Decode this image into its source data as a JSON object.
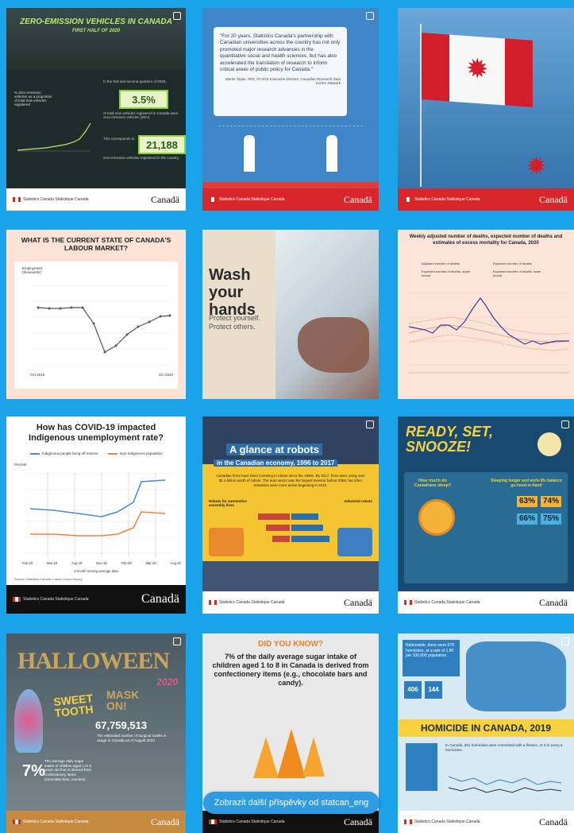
{
  "footer": {
    "canada": "Canadä",
    "gov": "Statistics Canada  Statistique Canada"
  },
  "tiles": {
    "t1": {
      "title": "ZERO-EMISSION VEHICLES IN CANADA",
      "subtitle": "FIRST HALF OF 2020",
      "stat1": "3.5%",
      "stat2": "21,188",
      "note1": "In the first and second quarters of 2020,",
      "note2": "of total new vehicles registered in Canada were zero-emission vehicles (ZEV).",
      "note3": "This corresponds to",
      "note4": "zero-emission vehicles registered in the country.",
      "chart_label": "% Zero-emission vehicles as a proportion of total new vehicles registered"
    },
    "t2": {
      "quote": "\"For 20 years, Statistics Canada's partnership with Canadian universities across the country has not only promoted major research advances in the quantitative social and health sciences, but has also accelerated the translation of research to inform critical areas of public policy for Canada.\"",
      "attribution": "Martin Taylor, PhD, FCAHS Executive Director, Canadian Research Data Centre Network"
    },
    "t4": {
      "title": "WHAT IS THE CURRENT STATE OF CANADA'S LABOUR MARKET?",
      "ylabel": "Employment (thousands)",
      "x_start": "Oct 2019",
      "x_end": "Oct 2020"
    },
    "t5": {
      "title": "Wash your hands",
      "subtitle": "Protect yourself. Protect others."
    },
    "t6": {
      "title": "Weekly adjusted number of deaths, expected number of deaths and estimates of excess mortality for Canada, 2020",
      "legend": [
        "Adjusted number of deaths",
        "Expected number of deaths",
        "Expected number of deaths, upper bound",
        "Expected number of deaths, lower bound"
      ]
    },
    "t7": {
      "title": "How has COVID-19 impacted Indigenous unemployment rate?",
      "legend1": "Indigenous people living off reserve",
      "legend2": "Non-Indigenous population",
      "ylabel": "Percent",
      "xlabel": "3-month moving average data",
      "source": "Source: Statistics Canada, Labour Force Survey",
      "xticks": [
        "Feb-19",
        "Mar-19",
        "Aug-19",
        "Nov-19",
        "Feb-20",
        "Mar-20",
        "Aug-20"
      ]
    },
    "t8": {
      "title": "A glance at robots",
      "subtitle": "in the Canadian economy, 1996 to 2017",
      "intro": "Canadian firms have been investing in robots since the 1990s. By 2017, firms were using over $1.5 billion worth of robots. The auto sector was the largest investor before 2008, but other industries were more active beginning in 2010.",
      "left_label": "Robots for automotive assembly lines",
      "right_label": "Industrial robots"
    },
    "t9": {
      "title": "READY, SET, SNOOZE!",
      "question": "How much do Canadians sleep?",
      "subtitle": "Sleeping longer and work-life balance go hand-in-hand",
      "women_pct1": "63%",
      "women_pct2": "74%",
      "men_pct1": "66%",
      "men_pct2": "75%"
    },
    "t10": {
      "title": "HALLOWEEN",
      "year": "2020",
      "sweet": "SWEET TOOTH",
      "mask": "MASK ON!",
      "pct": "7%",
      "number": "67,759,513",
      "desc1": "The average daily sugar intake of children aged 1 to 8 years old that is derived from confectionery items (chocolate bars, candies).",
      "desc2": "The estimated number of surgical masks in usage in Canada as of August 2020"
    },
    "t11": {
      "kicker": "DID YOU KNOW?",
      "body": "7% of the daily average sugar intake of children aged 1 to 8 in Canada is derived from confectionery items (e.g., chocolate bars and candy)."
    },
    "t12": {
      "intro": "Nationwide, there were 678 homicides, at a rate of 1.80 per 100,000 population.",
      "box1": "406",
      "box2": "144",
      "title": "HOMICIDE IN CANADA, 2019",
      "stat_text": "In Canada, 261 homicides were committed with a firearm, or 2 in every 5 homicides."
    }
  },
  "more_button": "Zobrazit další příspěvky od statcan_eng"
}
